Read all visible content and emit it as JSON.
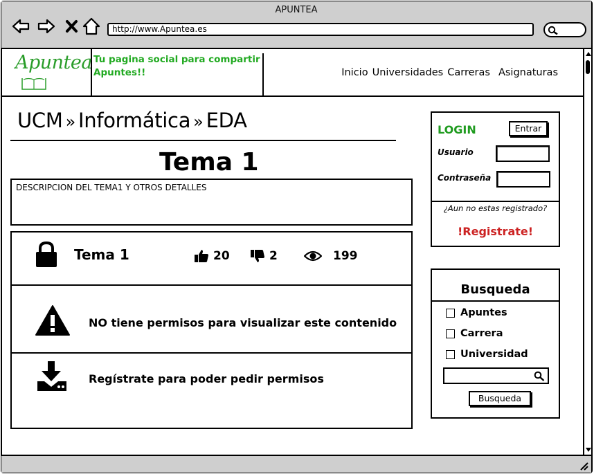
{
  "window": {
    "title": "APUNTEA"
  },
  "browser": {
    "url": "http://www.Apuntea.es",
    "icons": [
      "back-arrow-icon",
      "forward-arrow-icon",
      "close-x-icon",
      "home-icon",
      "search-icon"
    ]
  },
  "header": {
    "logo_text": "Apuntea",
    "slogan": "Tu pagina social para compartir Apuntes!!",
    "nav": [
      "Inicio",
      "Universidades",
      "Carreras",
      "Asignaturas"
    ]
  },
  "breadcrumb": {
    "items": [
      "UCM",
      "Informática",
      "EDA"
    ],
    "separator": "»"
  },
  "page_title": "Tema 1",
  "description": "DESCRIPCION DEL TEMA1 Y OTROS DETALLES",
  "content": {
    "name": "Tema 1",
    "likes": "20",
    "dislikes": "2",
    "views": "199",
    "no_permission": "NO tiene permisos para visualizar este contenido",
    "register_prompt": "Regístrate para poder pedir permisos"
  },
  "login": {
    "title": "LOGIN",
    "enter_label": "Entrar",
    "user_label": "Usuario",
    "password_label": "Contraseña",
    "not_registered": "¿Aun no estas registrado?",
    "register_link": "!Registrate!"
  },
  "search": {
    "title": "Busqueda",
    "options": [
      "Apuntes",
      "Carrera",
      "Universidad"
    ],
    "input_value": "",
    "button_label": "Busqueda"
  },
  "colors": {
    "chrome_bg": "#cfcfcf",
    "brand_green": "#22aa22",
    "register_red": "#cc2222"
  }
}
